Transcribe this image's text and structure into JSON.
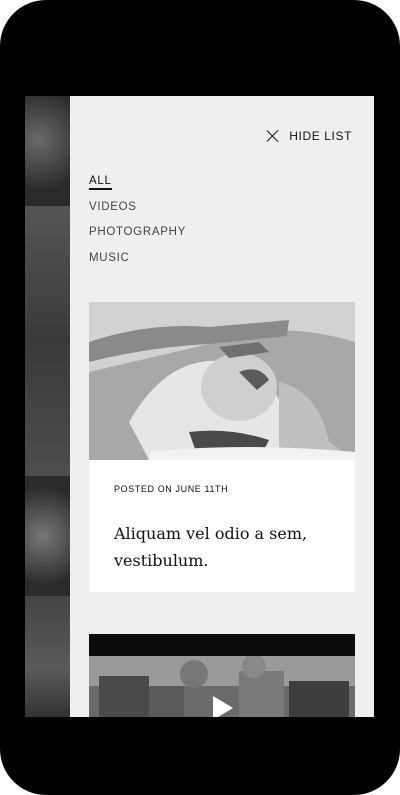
{
  "header": {
    "hide_label": "HIDE LIST",
    "close_icon": "close-icon"
  },
  "filters": [
    {
      "label": "ALL",
      "active": true
    },
    {
      "label": "VIDEOS",
      "active": false
    },
    {
      "label": "PHOTOGRAPHY",
      "active": false
    },
    {
      "label": "MUSIC",
      "active": false
    }
  ],
  "posts": [
    {
      "type": "photo",
      "meta": "POSTED ON JUNE 11TH",
      "title": "Aliquam vel odio a sem, vestibulum."
    },
    {
      "type": "video",
      "icon": "play-icon"
    }
  ],
  "colors": {
    "panel_bg": "#efefef",
    "frame": "#000000",
    "text": "#111111"
  }
}
